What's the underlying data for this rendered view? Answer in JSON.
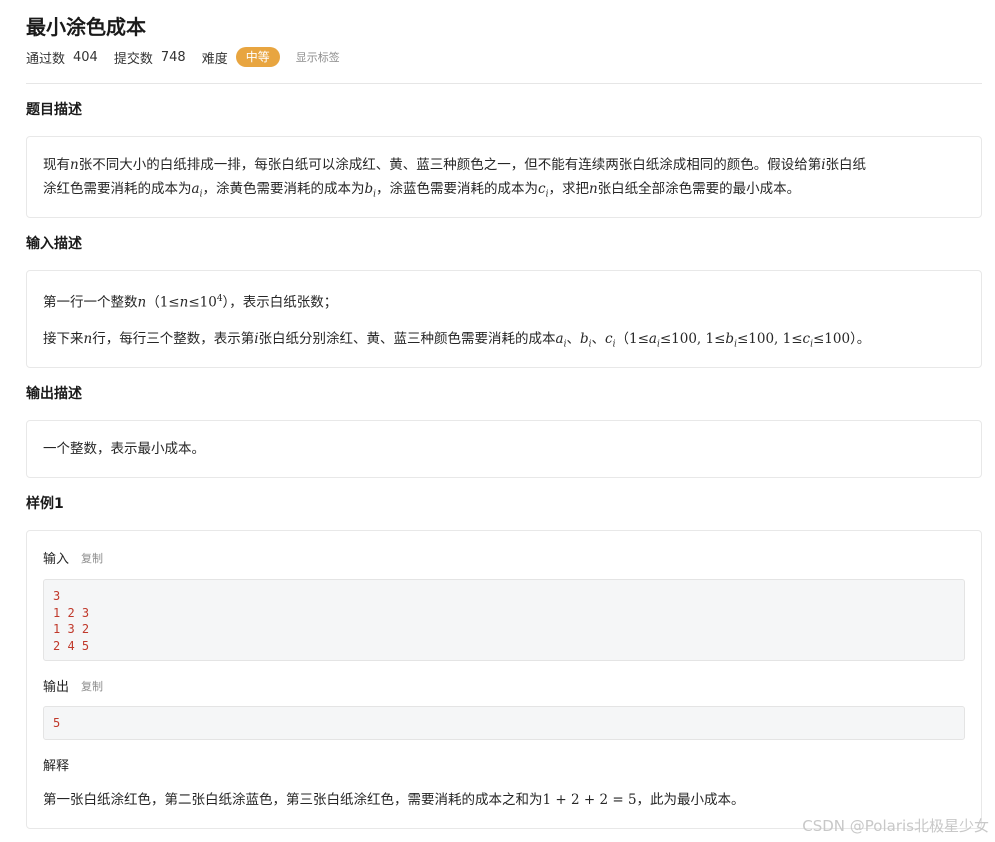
{
  "problem": {
    "title": "最小涂色成本",
    "pass_label": "通过数",
    "pass_count": "404",
    "submit_label": "提交数",
    "submit_count": "748",
    "difficulty_label": "难度",
    "difficulty": "中等",
    "show_tags": "显示标签",
    "colors": {
      "difficulty_badge": "#e8a540",
      "code_text": "#c0392b"
    }
  },
  "description": {
    "heading": "题目描述",
    "p1": [
      "现有",
      "n",
      "张不同大小的白纸排成一排，每张白纸可以涂成红、黄、蓝三种颜色之一，但不能有连续两张白纸涂成相同的颜色。假设给第",
      "i",
      "张白纸"
    ],
    "p2": [
      "涂红色需要消耗的成本为",
      "a",
      "i",
      "，涂黄色需要消耗的成本为",
      "b",
      "i",
      "，涂蓝色需要消耗的成本为",
      "c",
      "i",
      "，求把",
      "n",
      "张白纸全部涂色需要的最小成本。"
    ]
  },
  "input": {
    "heading": "输入描述",
    "line1": [
      "第一行一个整数",
      "n",
      "（",
      "1≤",
      "n",
      "≤10",
      "4",
      "），表示白纸张数；"
    ],
    "line2": [
      "接下来",
      "n",
      "行，每行三个整数，表示第",
      "i",
      "张白纸分别涂红、黄、蓝三种颜色需要消耗的成本",
      "a",
      "i",
      "、",
      "b",
      "i",
      "、",
      "c",
      "i",
      "（",
      "1≤",
      "a",
      "i",
      "≤100, 1≤",
      "b",
      "i",
      "≤100, 1≤",
      "c",
      "i",
      "≤100",
      "）。"
    ]
  },
  "output": {
    "heading": "输出描述",
    "text": "一个整数，表示最小成本。"
  },
  "sample": {
    "heading": "样例1",
    "input_label": "输入",
    "output_label": "输出",
    "copy_label": "复制",
    "input_lines": [
      "3",
      "1 2 3",
      "1 3 2",
      "2 4 5"
    ],
    "output_lines": [
      "5"
    ],
    "explain_label": "解释",
    "explain": [
      "第一张白纸涂红色，第二张白纸涂蓝色，第三张白纸涂红色，需要消耗的成本之和为",
      "1 + 2 + 2 = 5",
      "，此为最小成本。"
    ]
  },
  "watermark": "CSDN @Polaris北极星少女"
}
